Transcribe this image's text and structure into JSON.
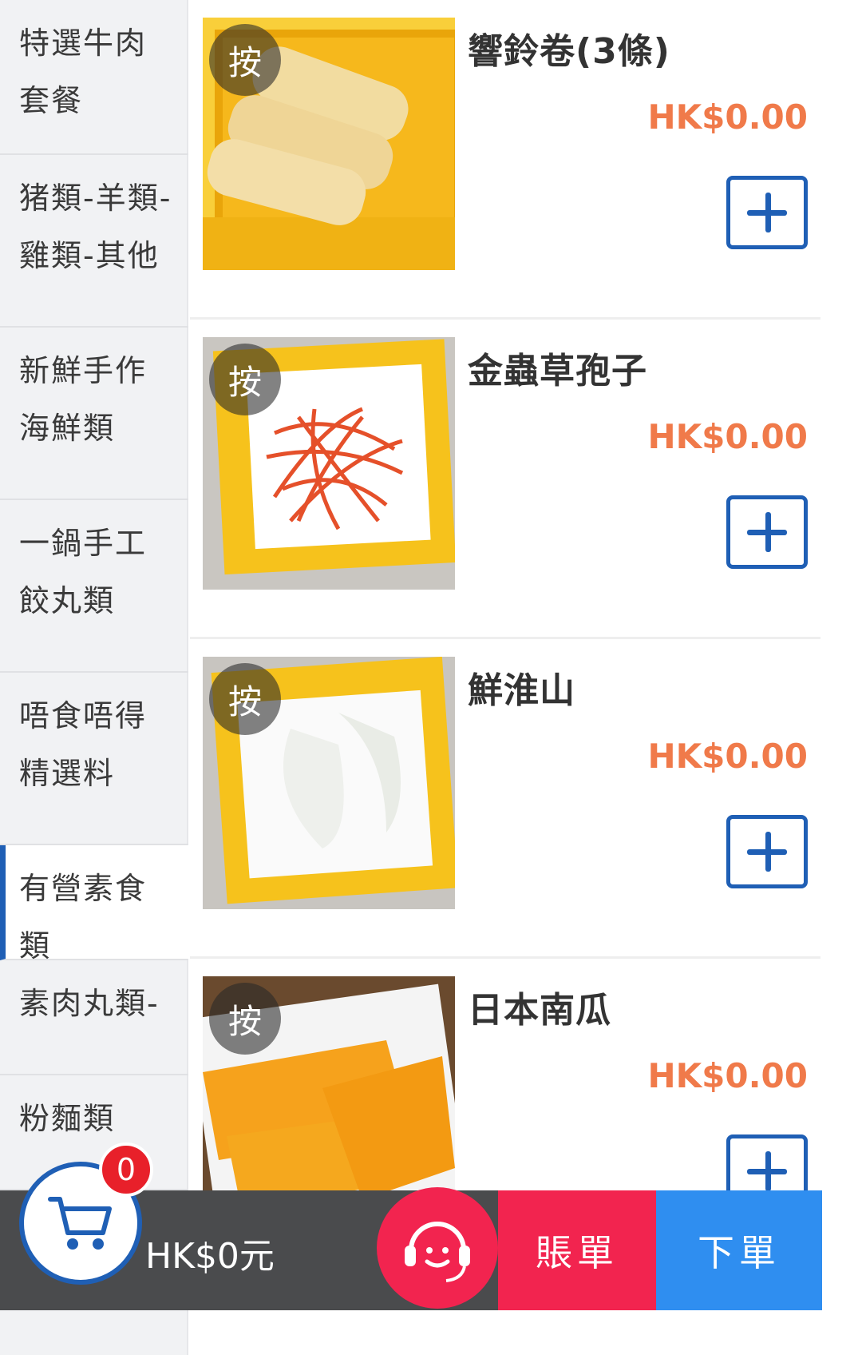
{
  "categories": [
    {
      "label": "特選牛肉套餐",
      "active": false
    },
    {
      "label": "猪類-羊類-雞類-其他",
      "active": false
    },
    {
      "label": "新鮮手作海鮮類",
      "active": false
    },
    {
      "label": "一鍋手工餃丸類",
      "active": false
    },
    {
      "label": "唔食唔得精選料",
      "active": false
    },
    {
      "label": "有營素食類",
      "active": true
    },
    {
      "label": "素肉丸類-",
      "active": false
    },
    {
      "label": "粉麵類",
      "active": false
    }
  ],
  "items": [
    {
      "name": "響鈴卷(3條)",
      "price": "HK$0.00",
      "press_label": "按"
    },
    {
      "name": "金蟲草孢子",
      "price": "HK$0.00",
      "press_label": "按"
    },
    {
      "name": "鮮淮山",
      "price": "HK$0.00",
      "press_label": "按"
    },
    {
      "name": "日本南瓜",
      "price": "HK$0.00",
      "press_label": "按"
    }
  ],
  "cart": {
    "count": "0",
    "total": "HK$0元"
  },
  "buttons": {
    "bill": "賬單",
    "order": "下單"
  },
  "colors": {
    "accent": "#1f5fb5",
    "price": "#f07a4a",
    "bill": "#f2244f",
    "order": "#2f8ef0",
    "bar": "#4a4b4d"
  }
}
